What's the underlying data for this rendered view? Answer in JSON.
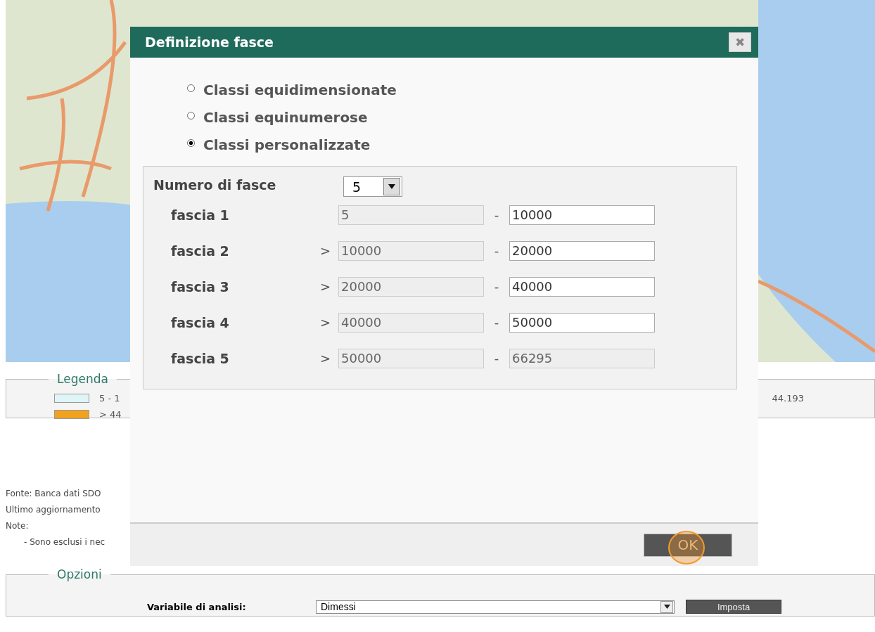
{
  "legend": {
    "title": "Legenda",
    "items": [
      {
        "label": "5 - 1",
        "color": "#dff5f7",
        "extra": "44.193"
      },
      {
        "label": "> 44",
        "color": "#f0a21e"
      }
    ]
  },
  "notes": {
    "lines": [
      "Fonte: Banca dati SDO",
      "Ultimo aggiornamento",
      "Note:"
    ],
    "bullets": [
      "- Sono esclusi i nec"
    ]
  },
  "options": {
    "title": "Opzioni",
    "field_label": "Variabile di analisi:",
    "select_value": "Dimessi",
    "button": "Imposta"
  },
  "dialog": {
    "title": "Definizione fasce",
    "close": "✖",
    "radios": [
      {
        "label": "Classi equidimensionate",
        "selected": false
      },
      {
        "label": "Classi equinumerose",
        "selected": false
      },
      {
        "label": "Classi personalizzate",
        "selected": true
      }
    ],
    "count_label": "Numero di fasce",
    "count_value": "5",
    "bands": [
      {
        "label": "fascia 1",
        "separator": "-",
        "from": {
          "value": "5",
          "disabled": true
        },
        "to": {
          "value": "10000",
          "disabled": false
        }
      },
      {
        "label": "fascia 2",
        "prefix": ">",
        "separator": "-",
        "from": {
          "value": "10000",
          "disabled": true
        },
        "to": {
          "value": "20000",
          "disabled": false
        }
      },
      {
        "label": "fascia 3",
        "prefix": ">",
        "separator": "-",
        "from": {
          "value": "20000",
          "disabled": true
        },
        "to": {
          "value": "40000",
          "disabled": false
        }
      },
      {
        "label": "fascia 4",
        "prefix": ">",
        "separator": "-",
        "from": {
          "value": "40000",
          "disabled": true
        },
        "to": {
          "value": "50000",
          "disabled": false
        }
      },
      {
        "label": "fascia 5",
        "prefix": ">",
        "separator": "-",
        "from": {
          "value": "50000",
          "disabled": true
        },
        "to": {
          "value": "66295",
          "disabled": true
        }
      }
    ],
    "ok": {
      "label": "OK",
      "highlighted": true
    }
  }
}
